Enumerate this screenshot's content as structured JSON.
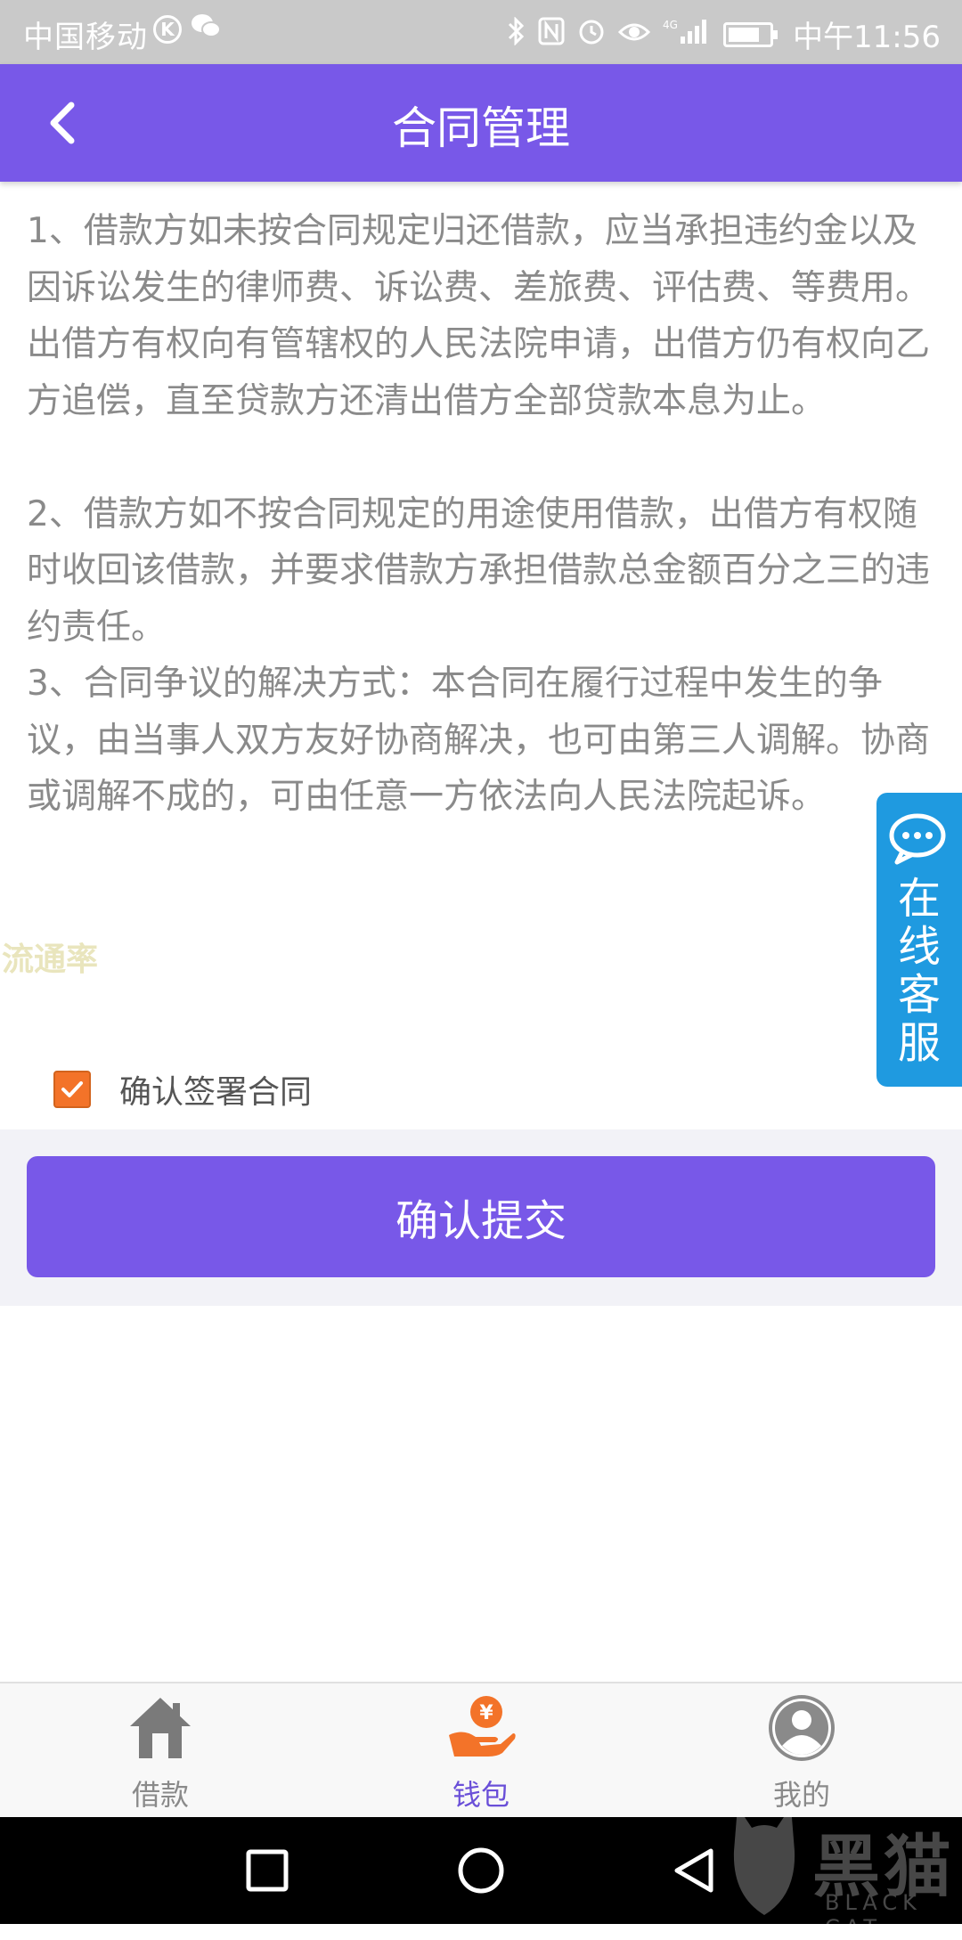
{
  "status_bar": {
    "carrier": "中国移动",
    "time": "中午11:56",
    "network": "4G"
  },
  "header": {
    "title": "合同管理"
  },
  "contract": {
    "clause1": "1、借款方如未按合同规定归还借款，应当承担违约金以及因诉讼发生的律师费、诉讼费、差旅费、评估费、等费用。\n出借方有权向有管辖权的人民法院申请，出借方仍有权向乙方追偿，直至贷款方还清出借方全部贷款本息为止。",
    "clause2": "2、借款方如不按合同规定的用途使用借款，出借方有权随时收回该借款，并要求借款方承担借款总金额百分之三的违约责任。",
    "clause3": "3、合同争议的解决方式：本合同在履行过程中发生的争议，由当事人双方友好协商解决，也可由第三人调解。协商或调解不成的，可由任意一方依法向人民法院起诉。"
  },
  "watermark": "流通率",
  "service": {
    "label": "在线客服",
    "color": "#1f9ae0"
  },
  "agreement": {
    "label": "确认签署合同",
    "checked": true
  },
  "submit": {
    "label": "确认提交"
  },
  "tabs": [
    {
      "label": "借款",
      "icon": "house-icon",
      "active": false
    },
    {
      "label": "钱包",
      "icon": "wallet-yen-icon",
      "active": true
    },
    {
      "label": "我的",
      "icon": "user-icon",
      "active": false
    }
  ],
  "brand_watermark": {
    "text": "黑猫",
    "sub": "BLACK CAT"
  },
  "colors": {
    "primary": "#7858e8",
    "accent": "#f37329",
    "active_tab": "#6a4fd8"
  }
}
